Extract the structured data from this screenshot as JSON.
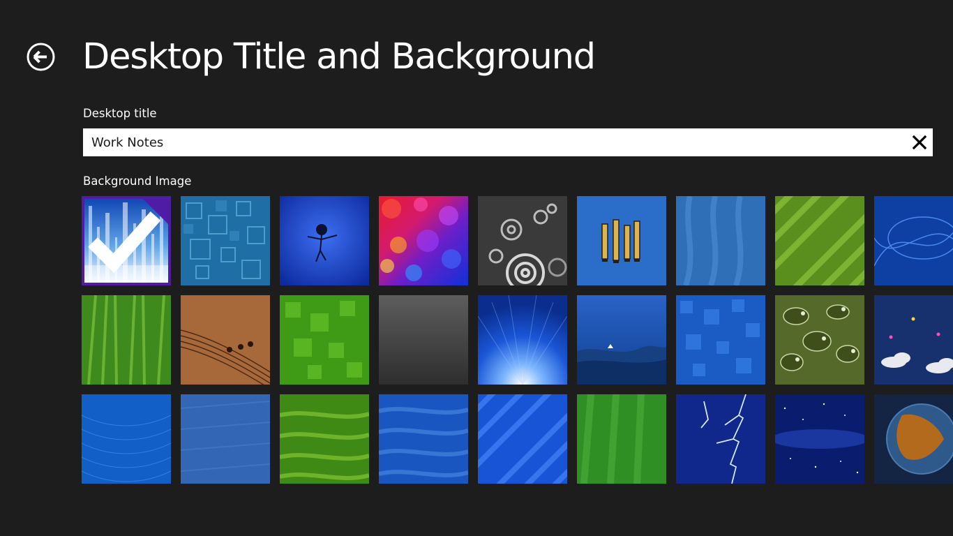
{
  "header": {
    "title": "Desktop Title and Background"
  },
  "form": {
    "title_label": "Desktop title",
    "title_value": "Work Notes",
    "background_label": "Background Image"
  },
  "colors": {
    "background": "#1d1d1d",
    "accent": "#4f1ca5",
    "text": "#ffffff"
  },
  "backgrounds": [
    {
      "name": "blue-light-streaks",
      "selected": true
    },
    {
      "name": "teal-squares",
      "selected": false
    },
    {
      "name": "blue-stick-figure",
      "selected": false
    },
    {
      "name": "rainbow-bokeh",
      "selected": false
    },
    {
      "name": "metal-gears",
      "selected": false
    },
    {
      "name": "pencils-on-blue",
      "selected": false
    },
    {
      "name": "blue-waves",
      "selected": false
    },
    {
      "name": "green-diagonal-stripes",
      "selected": false
    },
    {
      "name": "blue-swirls",
      "selected": false
    },
    {
      "name": "green-grass",
      "selected": false
    },
    {
      "name": "music-staff",
      "selected": false
    },
    {
      "name": "green-squares",
      "selected": false
    },
    {
      "name": "gray-texture",
      "selected": false
    },
    {
      "name": "blue-sunburst",
      "selected": false
    },
    {
      "name": "blue-ocean-horizon",
      "selected": false
    },
    {
      "name": "blue-mosaic",
      "selected": false
    },
    {
      "name": "green-cell-pattern",
      "selected": false
    },
    {
      "name": "clouds-and-planes",
      "selected": false
    },
    {
      "name": "blue-web",
      "selected": false
    },
    {
      "name": "blue-fabric",
      "selected": false
    },
    {
      "name": "green-curves",
      "selected": false
    },
    {
      "name": "blue-curves",
      "selected": false
    },
    {
      "name": "blue-diagonal-stripes",
      "selected": false
    },
    {
      "name": "green-fabric-folds",
      "selected": false
    },
    {
      "name": "blue-lightning",
      "selected": false
    },
    {
      "name": "starry-night",
      "selected": false
    },
    {
      "name": "earth-globe",
      "selected": false
    }
  ]
}
